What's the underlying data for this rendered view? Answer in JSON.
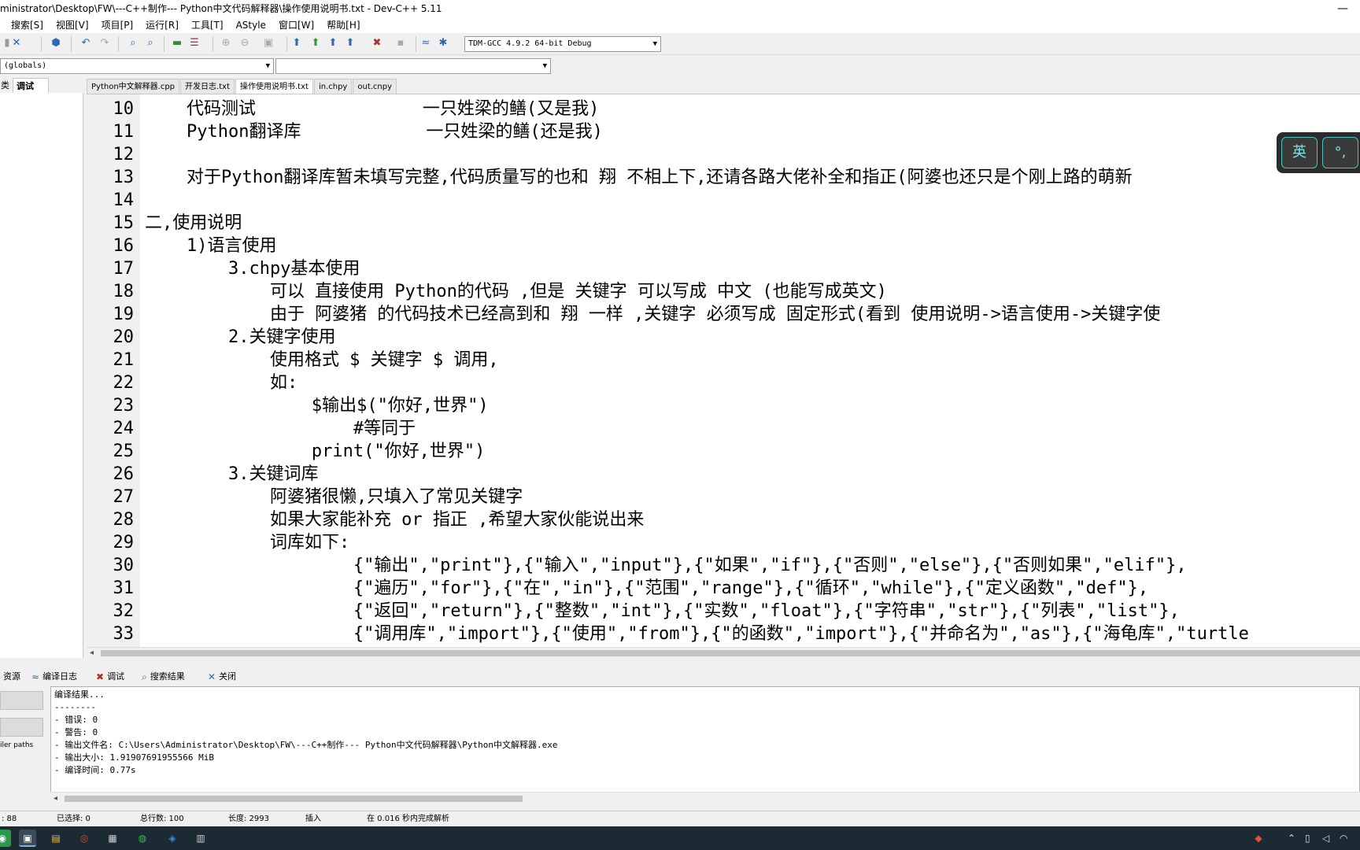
{
  "window": {
    "title": "ministrator\\Desktop\\FW\\---C++制作--- Python中文代码解释器\\操作使用说明书.txt - Dev-C++ 5.11",
    "minimize_glyph": "—"
  },
  "menu": [
    "搜索[S]",
    "视图[V]",
    "项目[P]",
    "运行[R]",
    "工具[T]",
    "AStyle",
    "窗口[W]",
    "帮助[H]"
  ],
  "toolbar": {
    "compiler": "TDM-GCC 4.9.2 64-bit Debug"
  },
  "scope": {
    "globals": "(globals)",
    "members": ""
  },
  "left_tabs": {
    "classes": "类",
    "debug": "调试"
  },
  "editor_tabs": [
    "Python中文解释器.cpp",
    "开发日志.txt",
    "操作使用说明书.txt",
    "in.chpy",
    "out.cnpy"
  ],
  "editor_lines": [
    {
      "n": "10",
      "t": "    代码测试                一只姓梁的鳝(又是我)"
    },
    {
      "n": "11",
      "t": "    Python翻译库            一只姓梁的鳝(还是我)"
    },
    {
      "n": "12",
      "t": ""
    },
    {
      "n": "13",
      "t": "    对于Python翻译库暂未填写完整,代码质量写的也和 翔 不相上下,还请各路大佬补全和指正(阿婆也还只是个刚上路的萌新"
    },
    {
      "n": "14",
      "t": ""
    },
    {
      "n": "15",
      "t": "二,使用说明"
    },
    {
      "n": "16",
      "t": "    1)语言使用"
    },
    {
      "n": "17",
      "t": "        3.chpy基本使用"
    },
    {
      "n": "18",
      "t": "            可以 直接使用 Python的代码 ,但是 关键字 可以写成 中文 (也能写成英文)"
    },
    {
      "n": "19",
      "t": "            由于 阿婆猪 的代码技术已经高到和 翔 一样 ,关键字 必须写成 固定形式(看到 使用说明->语言使用->关键字使"
    },
    {
      "n": "20",
      "t": "        2.关键字使用"
    },
    {
      "n": "21",
      "t": "            使用格式 $ 关键字 $ 调用,"
    },
    {
      "n": "22",
      "t": "            如:"
    },
    {
      "n": "23",
      "t": "                $输出$(\"你好,世界\")"
    },
    {
      "n": "24",
      "t": "                    #等同于"
    },
    {
      "n": "25",
      "t": "                print(\"你好,世界\")"
    },
    {
      "n": "26",
      "t": "        3.关键词库"
    },
    {
      "n": "27",
      "t": "            阿婆猪很懒,只填入了常见关键字"
    },
    {
      "n": "28",
      "t": "            如果大家能补充 or 指正 ,希望大家伙能说出来"
    },
    {
      "n": "29",
      "t": "            词库如下:"
    },
    {
      "n": "30",
      "t": "                    {\"输出\",\"print\"},{\"输入\",\"input\"},{\"如果\",\"if\"},{\"否则\",\"else\"},{\"否则如果\",\"elif\"},"
    },
    {
      "n": "31",
      "t": "                    {\"遍历\",\"for\"},{\"在\",\"in\"},{\"范围\",\"range\"},{\"循环\",\"while\"},{\"定义函数\",\"def\"},"
    },
    {
      "n": "32",
      "t": "                    {\"返回\",\"return\"},{\"整数\",\"int\"},{\"实数\",\"float\"},{\"字符串\",\"str\"},{\"列表\",\"list\"},"
    },
    {
      "n": "33",
      "t": "                    {\"调用库\",\"import\"},{\"使用\",\"from\"},{\"的函数\",\"import\"},{\"并命名为\",\"as\"},{\"海龟库\",\"turtle"
    }
  ],
  "ime": {
    "lang": "英",
    "punct": "°,"
  },
  "bottom_tabs": {
    "resources": "资源",
    "compile_log": "编译日志",
    "debug": "调试",
    "search_results": "搜索结果",
    "close": "关闭"
  },
  "bottom_left": {
    "compiler_paths": "iler paths"
  },
  "log_lines": [
    "编译结果...",
    "--------",
    "- 错误: 0",
    "- 警告: 0",
    "- 输出文件名: C:\\Users\\Administrator\\Desktop\\FW\\---C++制作--- Python中文代码解释器\\Python中文解释器.exe",
    "- 输出大小: 1.91907691955566 MiB",
    "- 编译时间: 0.77s"
  ],
  "status": {
    "col": ": 88",
    "selected": "已选择:  0",
    "total_lines": "总行数:  100",
    "length": "长度:  2993",
    "mode": "插入",
    "parse": "在 0.016 秒内完成解析"
  },
  "colors": {
    "accent": "#2a6ab0",
    "taskbar": "#1c2a33",
    "ime_border": "#4ac4c8"
  }
}
